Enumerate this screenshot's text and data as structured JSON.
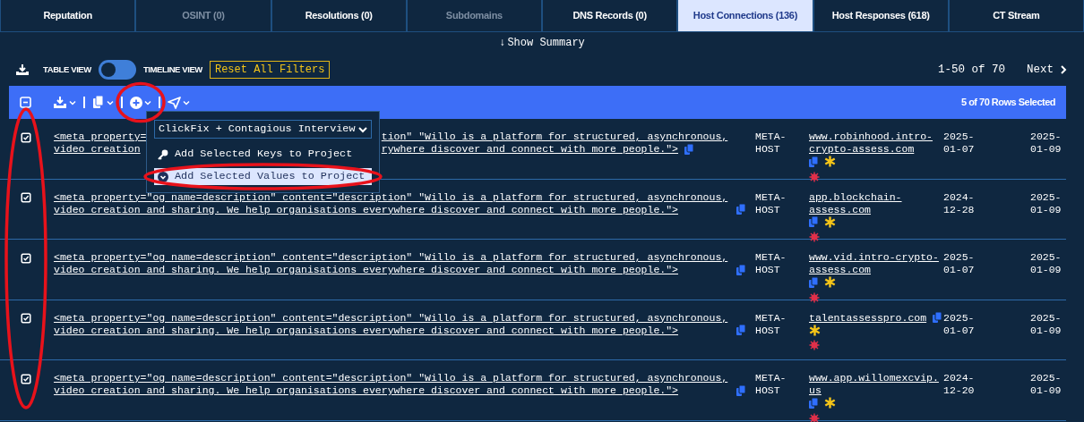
{
  "tabs": [
    {
      "label": "Reputation",
      "selected": false,
      "disabled": false
    },
    {
      "label": "OSINT (0)",
      "selected": false,
      "disabled": true
    },
    {
      "label": "Resolutions (0)",
      "selected": false,
      "disabled": false
    },
    {
      "label": "Subdomains",
      "selected": false,
      "disabled": true
    },
    {
      "label": "DNS Records (0)",
      "selected": false,
      "disabled": false
    },
    {
      "label": "Host Connections (136)",
      "selected": true,
      "disabled": false
    },
    {
      "label": "Host Responses (618)",
      "selected": false,
      "disabled": false
    },
    {
      "label": "CT Stream",
      "selected": false,
      "disabled": false
    }
  ],
  "summary_toggle": {
    "arrow": "↓",
    "label": "Show Summary"
  },
  "view_switch": {
    "left_label": "TABLE VIEW",
    "right_label": "TIMELINE VIEW",
    "on": false
  },
  "reset_button": "Reset All Filters",
  "pagination": {
    "range": "1-50 of 70",
    "next": "Next"
  },
  "toolbar": {
    "select_all_indeterminate": true,
    "add_button_circled": true,
    "selection_count": "5 of 70 Rows Selected"
  },
  "project_menu": {
    "project": "ClickFix + Contagious Interview",
    "items": [
      {
        "kind": "keys",
        "label": "Add Selected Keys to Project",
        "selected": false,
        "circled": false
      },
      {
        "kind": "values",
        "label": "Add Selected Values to Project",
        "selected": true,
        "circled": true
      }
    ]
  },
  "table": {
    "checkboxes_circled": true,
    "rows": [
      {
        "checked": true,
        "response_lines": [
          [
            "<meta property=",
            "tion\" \"Willo is a platform for structured, asynchronous,"
          ],
          [
            "video creation",
            "rywhere discover and connect with more people.\">"
          ]
        ],
        "type": "META-HOST",
        "host": "www.robinhood.intro-crypto-assess.com",
        "first_seen": "2025-01-07",
        "last_seen": "2025-01-09"
      },
      {
        "checked": true,
        "response": "<meta property=\"og name=description\" content=\"description\" \"Willo is a platform for structured, asynchronous, video creation and sharing. We help organisations everywhere discover and connect with more people.\">",
        "type": "META-HOST",
        "host": "app.blockchain-assess.com",
        "first_seen": "2024-12-28",
        "last_seen": "2025-01-09"
      },
      {
        "checked": true,
        "response": "<meta property=\"og name=description\" content=\"description\" \"Willo is a platform for structured, asynchronous, video creation and sharing. We help organisations everywhere discover and connect with more people.\">",
        "type": "META-HOST",
        "host": "www.vid.intro-crypto-assess.com",
        "first_seen": "2025-01-07",
        "last_seen": "2025-01-09"
      },
      {
        "checked": true,
        "response": "<meta property=\"og name=description\" content=\"description\" \"Willo is a platform for structured, asynchronous, video creation and sharing. We help organisations everywhere discover and connect with more people.\">",
        "type": "META-HOST",
        "host": "talentassesspro.com",
        "first_seen": "2025-01-07",
        "last_seen": "2025-01-09"
      },
      {
        "checked": true,
        "response": "<meta property=\"og name=description\" content=\"description\" \"Willo is a platform for structured, asynchronous, video creation and sharing. We help organisations everywhere discover and connect with more people.\">",
        "type": "META-HOST",
        "host": "www.app.willomexcvip.us",
        "first_seen": "2024-12-20",
        "last_seen": "2025-01-09"
      }
    ]
  }
}
